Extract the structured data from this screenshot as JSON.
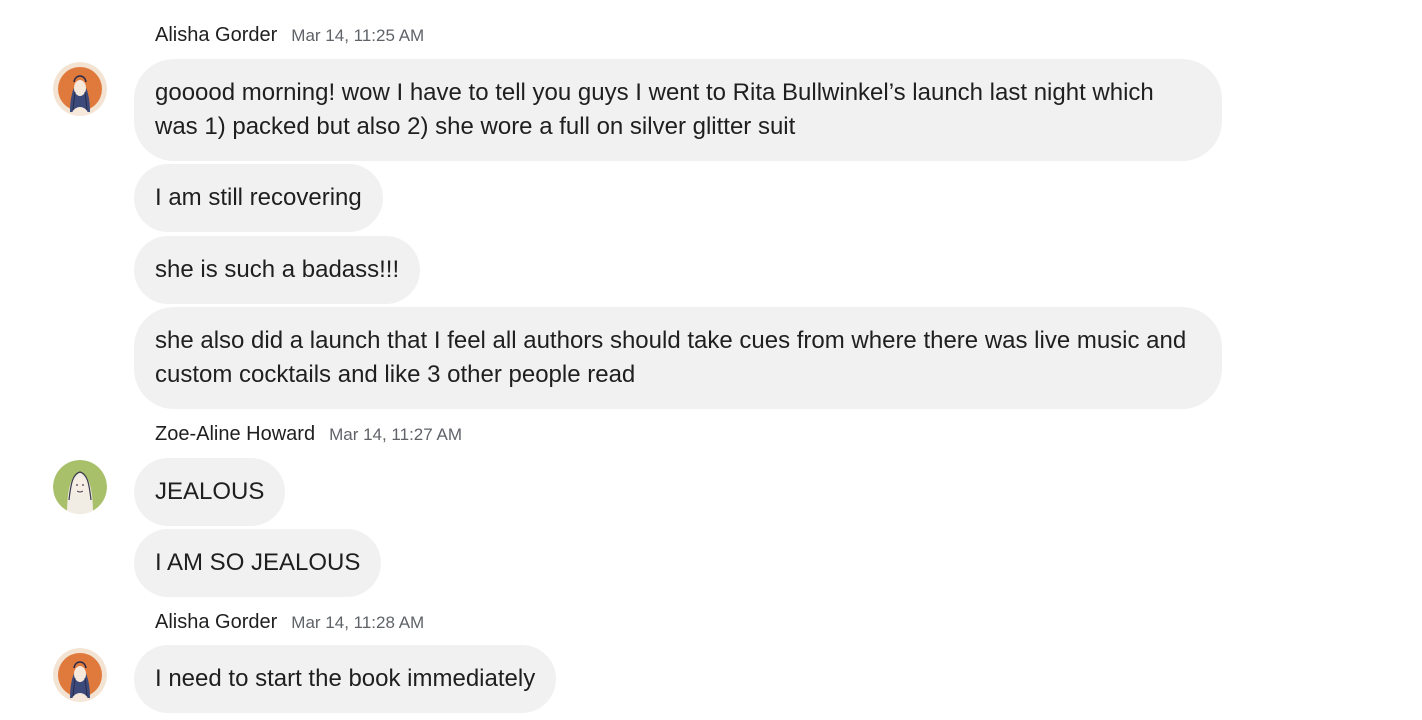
{
  "messages": [
    {
      "sender": "Alisha Gorder",
      "timestamp": "Mar 14, 11:25 AM",
      "avatar_icon": "avatar-alisha-icon",
      "bubbles": [
        "gooood morning! wow I have to tell you guys I went to Rita Bullwinkel’s launch last night which was 1) packed but also 2) she wore a full on silver glitter suit",
        "I am still recovering",
        "she is such a badass!!!",
        "she also did a launch that I feel all authors should take cues from where there was live music and custom cocktails and like 3 other people read"
      ]
    },
    {
      "sender": "Zoe-Aline Howard",
      "timestamp": "Mar 14, 11:27 AM",
      "avatar_icon": "avatar-zoe-icon",
      "bubbles": [
        "JEALOUS",
        "I AM SO JEALOUS"
      ]
    },
    {
      "sender": "Alisha Gorder",
      "timestamp": "Mar 14, 11:28 AM",
      "avatar_icon": "avatar-alisha-icon",
      "bubbles": [
        "I need to start the book immediately"
      ]
    }
  ],
  "colors": {
    "bubble_bg": "#f1f1f1",
    "alisha_avatar_bg": "#e07a3c",
    "zoe_avatar_bg": "#a9c06a",
    "timestamp": "#5f6368"
  }
}
